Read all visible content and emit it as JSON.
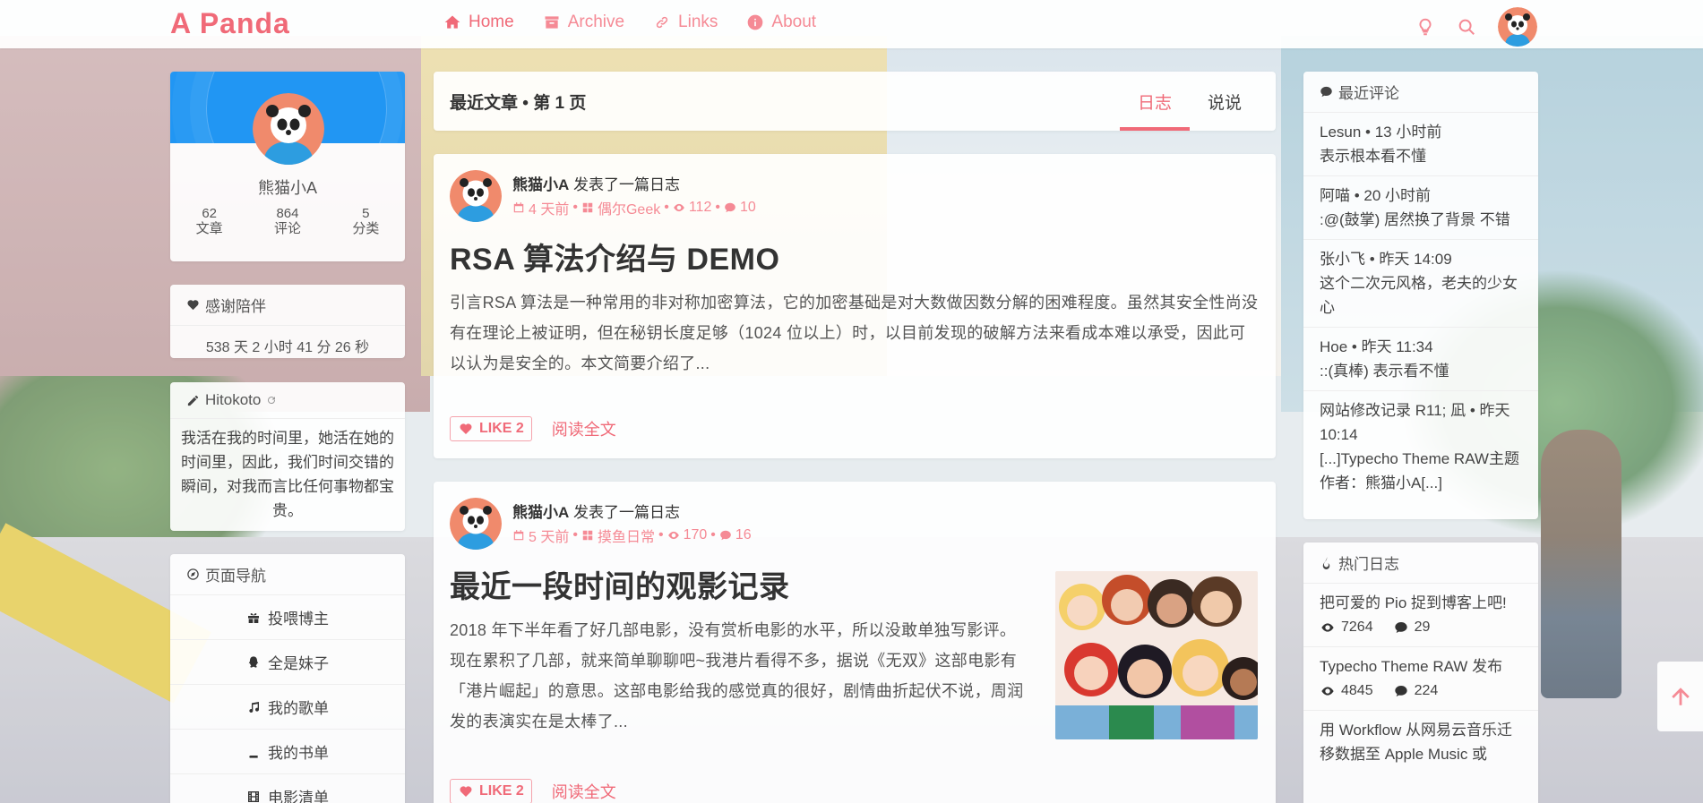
{
  "site": {
    "brand": "A Panda"
  },
  "nav": {
    "items": [
      {
        "label": "Home",
        "icon": "home-icon",
        "active": true
      },
      {
        "label": "Archive",
        "icon": "archive-icon"
      },
      {
        "label": "Links",
        "icon": "link-icon"
      },
      {
        "label": "About",
        "icon": "info-icon"
      }
    ],
    "right_icons": [
      "lightbulb-icon",
      "search-icon"
    ]
  },
  "profile": {
    "name": "熊猫小A",
    "stats": [
      {
        "value": "62",
        "label": "文章"
      },
      {
        "value": "864",
        "label": "评论"
      },
      {
        "value": "5",
        "label": "分类"
      }
    ]
  },
  "uptime": {
    "title": "感谢陪伴",
    "text": "538 天 2 小时 41 分 26 秒"
  },
  "hitokoto": {
    "title": "Hitokoto",
    "text": "我活在我的时间里，她活在她的时间里，因此，我们时间交错的瞬间，对我而言比任何事物都宝贵。"
  },
  "page_nav": {
    "title": "页面导航",
    "items": [
      {
        "label": "投喂博主",
        "icon": "gift-icon"
      },
      {
        "label": "全是妹子",
        "icon": "qq-icon"
      },
      {
        "label": "我的歌单",
        "icon": "music-icon"
      },
      {
        "label": "我的书单",
        "icon": "book-icon"
      },
      {
        "label": "电影清单",
        "icon": "film-icon"
      }
    ]
  },
  "posts_header": {
    "title": "最近文章 • 第 1 页",
    "tabs": [
      {
        "label": "日志",
        "active": true
      },
      {
        "label": "说说"
      }
    ]
  },
  "posts": [
    {
      "author": "熊猫小A",
      "action": "发表了一篇日志",
      "time": "4 天前",
      "category": "偶尔Geek",
      "views": "112",
      "comments": "10",
      "title": "RSA 算法介绍与 DEMO",
      "excerpt": "引言RSA 算法是一种常用的非对称加密算法，它的加密基础是对大数做因数分解的困难程度。虽然其安全性尚没有在理论上被证明，但在秘钥长度足够（1024 位以上）时，以目前发现的破解方法来看成本难以承受，因此可以认为是安全的。本文简要介绍了...",
      "like_label": "LIKE 2",
      "read_more": "阅读全文"
    },
    {
      "author": "熊猫小A",
      "action": "发表了一篇日志",
      "time": "5 天前",
      "category": "摸鱼日常",
      "views": "170",
      "comments": "16",
      "title": "最近一段时间的观影记录",
      "excerpt": "2018 年下半年看了好几部电影，没有赏析电影的水平，所以没敢单独写影评。现在累积了几部，就来简单聊聊吧~我港片看得不多，据说《无双》这部电影有「港片崛起」的意思。这部电影给我的感觉真的很好，剧情曲折起伏不说，周润发的表演实在是太棒了...",
      "like_label": "LIKE 2",
      "read_more": "阅读全文"
    }
  ],
  "recent_comments": {
    "title": "最近评论",
    "items": [
      {
        "head": "Lesun • 13 小时前",
        "body": "表示根本看不懂"
      },
      {
        "head": "阿喵 • 20 小时前",
        "body": ":@(鼓掌) 居然换了背景 不错"
      },
      {
        "head": "张小飞 • 昨天 14:09",
        "body": "这个二次元风格，老夫的少女心"
      },
      {
        "head": "Hoe • 昨天 11:34",
        "body": "::(真棒) 表示看不懂"
      },
      {
        "head": "网站修改记录 R11; 凪 • 昨天 10:14",
        "body": "[...]Typecho Theme RAW主题作者：熊猫小A[...]"
      }
    ]
  },
  "hot_posts": {
    "title": "热门日志",
    "items": [
      {
        "title": "把可爱的 Pio 捉到博客上吧!",
        "views": "7264",
        "comments": "29"
      },
      {
        "title": "Typecho Theme RAW 发布",
        "views": "4845",
        "comments": "224"
      },
      {
        "title": "用 Workflow 从网易云音乐迁移数据至 Apple Music 或",
        "views": "",
        "comments": ""
      }
    ]
  },
  "colors": {
    "accent": "#f06a78",
    "accent_light": "#f58a95",
    "banner": "#2196f3"
  }
}
